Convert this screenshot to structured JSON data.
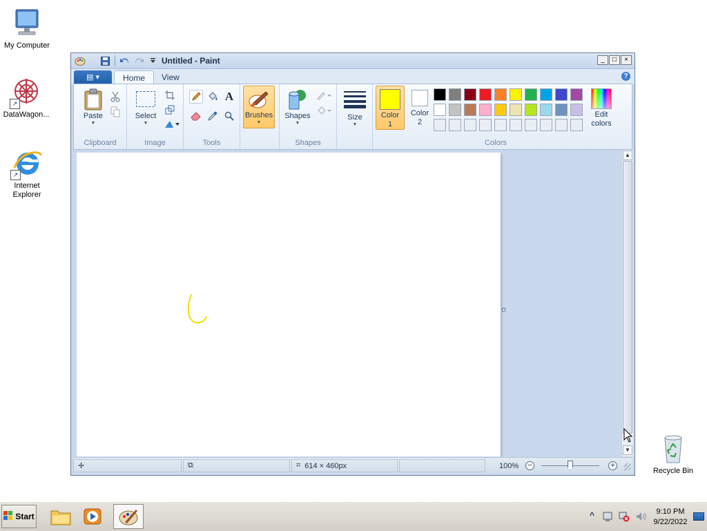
{
  "desktop": {
    "icons": [
      {
        "label": "My Computer"
      },
      {
        "label": "DataWagon..."
      },
      {
        "label": "Internet Explorer"
      },
      {
        "label": "Recycle Bin"
      }
    ]
  },
  "window": {
    "title": "Untitled - Paint",
    "file_tab_glyph": "▤ ▾",
    "tabs": [
      {
        "label": "Home",
        "active": true
      },
      {
        "label": "View",
        "active": false
      }
    ],
    "help": "?",
    "controls": {
      "minimize": "_",
      "maximize": "□",
      "close": "×"
    }
  },
  "ribbon": {
    "groups": {
      "clipboard": {
        "label": "Clipboard",
        "paste": "Paste"
      },
      "image": {
        "label": "Image",
        "select": "Select"
      },
      "tools": {
        "label": "Tools"
      },
      "brushes": {
        "label": "Brushes"
      },
      "shapes": {
        "label": "Shapes",
        "shapes_btn": "Shapes"
      },
      "size": {
        "label": "Size"
      },
      "colors": {
        "label": "Colors",
        "color1": "Color 1",
        "color1_line1": "Color",
        "color1_line2": "1",
        "color2": "Color 2",
        "color2_line1": "Color",
        "color2_line2": "2",
        "edit_line1": "Edit",
        "edit_line2": "colors",
        "color1_value": "#ffff00",
        "color2_value": "#ffffff",
        "palette_row1": [
          "#000000",
          "#7f7f7f",
          "#880015",
          "#ed1c24",
          "#ff7f27",
          "#fff200",
          "#22b14c",
          "#00a2e8",
          "#3f48cc",
          "#a349a4"
        ],
        "palette_row2": [
          "#ffffff",
          "#c3c3c3",
          "#b97a57",
          "#ffaec9",
          "#ffc90e",
          "#efe4b0",
          "#b5e61d",
          "#99d9ea",
          "#7092be",
          "#c8bfe7"
        ],
        "palette_row3": [
          "#e9eef5",
          "#e9eef5",
          "#e9eef5",
          "#e9eef5",
          "#e9eef5",
          "#e9eef5",
          "#e9eef5",
          "#e9eef5",
          "#e9eef5",
          "#e9eef5"
        ]
      }
    }
  },
  "statusbar": {
    "canvas_size": "614 × 460px",
    "zoom": "100%",
    "zoom_out": "−",
    "zoom_in": "+",
    "zoom_level": 0.5
  },
  "taskbar": {
    "start": "Start",
    "time": "9:10 PM",
    "date": "9/22/2022",
    "tray_chevron": "^"
  }
}
